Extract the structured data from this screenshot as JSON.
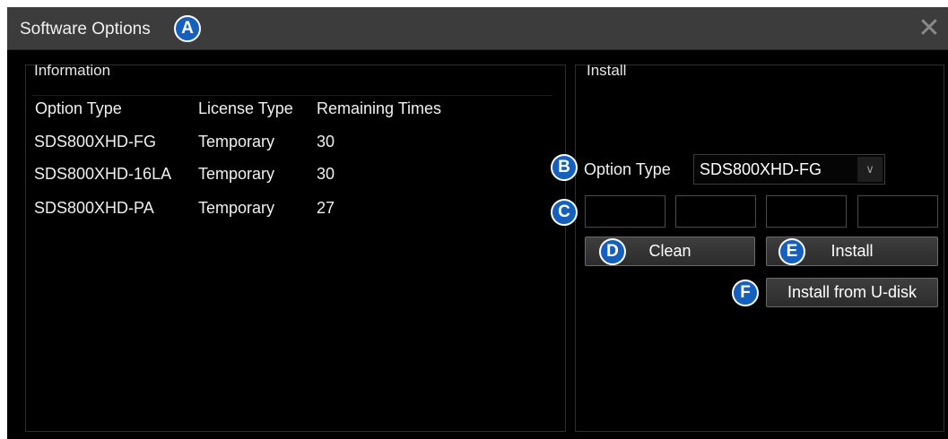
{
  "title": "Software Options",
  "callouts": {
    "a": "A",
    "b": "B",
    "c": "C",
    "d": "D",
    "e": "E",
    "f": "F"
  },
  "information": {
    "label": "Information",
    "columns": [
      "Option Type",
      "License Type",
      "Remaining Times"
    ],
    "rows": [
      {
        "option": "SDS800XHD-FG",
        "license": "Temporary",
        "remaining": "30"
      },
      {
        "option": "SDS800XHD-16LA",
        "license": "Temporary",
        "remaining": "30"
      },
      {
        "option": "SDS800XHD-PA",
        "license": "Temporary",
        "remaining": "27"
      }
    ]
  },
  "install": {
    "label": "Install",
    "option_type_label": "Option Type",
    "option_type_value": "SDS800XHD-FG",
    "key_fields": [
      "",
      "",
      "",
      ""
    ],
    "clean_label": "Clean",
    "install_label": "Install",
    "udisk_label": "Install from U-disk"
  },
  "colors": {
    "callout": "#1560bd",
    "titlebar": "#3c3c3c",
    "background": "#000000"
  },
  "icons": {
    "close": "close-icon",
    "dropdown": "chevron-down-icon"
  }
}
